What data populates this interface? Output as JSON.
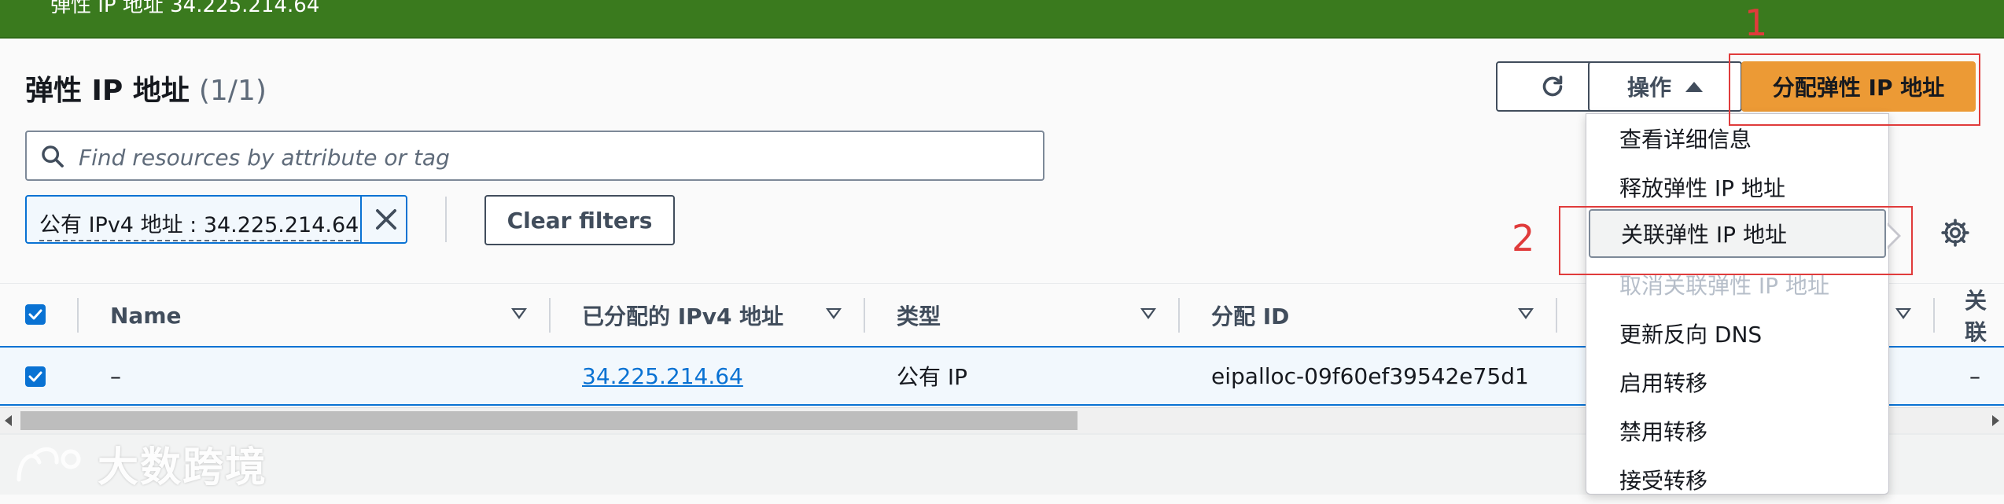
{
  "flash": {
    "text": "弹性 IP 地址 34.225.214.64"
  },
  "header": {
    "title": "弹性 IP 地址",
    "count": "(1/1)"
  },
  "toolbar": {
    "actions_label": "操作",
    "allocate_label": "分配弹性 IP 地址"
  },
  "search": {
    "placeholder": "Find resources by attribute or tag"
  },
  "filter": {
    "token_label": "公有 IPv4 地址 : 34.225.214.64",
    "clear_label": "Clear filters"
  },
  "table": {
    "columns": [
      "Name",
      "已分配的 IPv4 地址",
      "类型",
      "分配 ID",
      "关联"
    ],
    "rows": [
      {
        "name": "–",
        "ipv4": "34.225.214.64",
        "type": "公有 IP",
        "allocation_id": "eipalloc-09f60ef39542e75d1",
        "assoc": "–"
      }
    ]
  },
  "actions_menu": {
    "items": [
      {
        "label": "查看详细信息",
        "state": "normal"
      },
      {
        "label": "释放弹性 IP 地址",
        "state": "normal"
      },
      {
        "label": "关联弹性 IP 地址",
        "state": "hover"
      },
      {
        "label": "取消关联弹性 IP 地址",
        "state": "disabled"
      },
      {
        "label": "更新反向 DNS",
        "state": "normal"
      },
      {
        "label": "启用转移",
        "state": "normal"
      },
      {
        "label": "禁用转移",
        "state": "normal"
      },
      {
        "label": "接受转移",
        "state": "normal"
      }
    ]
  },
  "annotations": {
    "one": "1",
    "two": "2"
  },
  "watermark": {
    "text": "大数跨境"
  },
  "colors": {
    "flash_green": "#3a7a1e",
    "primary_orange": "#ec9a35",
    "link_blue": "#0972d3",
    "annotation_red": "#e03b3b"
  }
}
